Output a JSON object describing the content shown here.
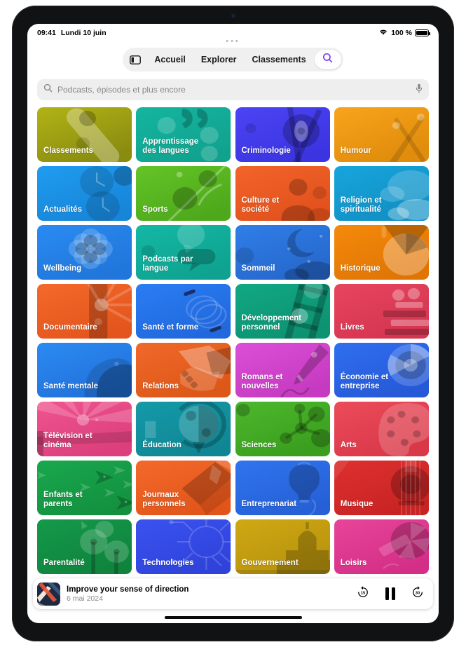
{
  "status_bar": {
    "time": "09:41",
    "date": "Lundi 10 juin",
    "battery_percent": "100 %",
    "wifi_icon": "wifi-icon",
    "battery_icon": "battery-full-icon"
  },
  "nav": {
    "sidebar_icon": "sidebar-toggle-icon",
    "items": [
      {
        "label": "Accueil"
      },
      {
        "label": "Explorer"
      },
      {
        "label": "Classements"
      }
    ],
    "search_icon": "search-icon",
    "search_icon_color": "#7d3ff2"
  },
  "search": {
    "placeholder": "Podcasts, épisodes et plus encore",
    "value": "",
    "leading_icon": "search-icon",
    "trailing_icon": "microphone-icon"
  },
  "categories": [
    {
      "label": "Classements",
      "art": "ranking",
      "c1": "#b2b316",
      "c2": "#8a8c10"
    },
    {
      "label": "Apprentissage des langues",
      "art": "quotes",
      "c1": "#14b5a0",
      "c2": "#11a28e"
    },
    {
      "label": "Criminologie",
      "art": "eye",
      "c1": "#4b44f5",
      "c2": "#3b34e0"
    },
    {
      "label": "Humour",
      "art": "confetti",
      "c1": "#f8a41c",
      "c2": "#e08c0c"
    },
    {
      "label": "Actualités",
      "art": "clocks",
      "c1": "#1f9cf0",
      "c2": "#1785d8"
    },
    {
      "label": "Sports",
      "art": "leaf",
      "c1": "#63c426",
      "c2": "#4ea81c"
    },
    {
      "label": "Culture et société",
      "art": "people",
      "c1": "#f2642a",
      "c2": "#e2511c"
    },
    {
      "label": "Religion et spiritualité",
      "art": "clouds",
      "c1": "#17a5dc",
      "c2": "#1190c4"
    },
    {
      "label": "Wellbeing",
      "art": "flower",
      "c1": "#2a8bf2",
      "c2": "#2076da"
    },
    {
      "label": "Podcasts par langue",
      "art": "bubbles",
      "c1": "#13b8a4",
      "c2": "#0fa290"
    },
    {
      "label": "Sommeil",
      "art": "moon",
      "c1": "#2f7ee8",
      "c2": "#2668cc"
    },
    {
      "label": "Historique",
      "art": "pie",
      "c1": "#f58a0b",
      "c2": "#e07505"
    },
    {
      "label": "Documentaire",
      "art": "filmstrip",
      "c1": "#f4692b",
      "c2": "#e3551c"
    },
    {
      "label": "Santé et forme",
      "art": "skipping",
      "c1": "#2a7df4",
      "c2": "#2168dc"
    },
    {
      "label": "Développement personnel",
      "art": "ladder",
      "c1": "#11a883",
      "c2": "#0d9272"
    },
    {
      "label": "Livres",
      "art": "books",
      "c1": "#e8455f",
      "c2": "#d43550"
    },
    {
      "label": "Santé mentale",
      "art": "heads",
      "c1": "#2a8bf2",
      "c2": "#2271da"
    },
    {
      "label": "Relations",
      "art": "handshake",
      "c1": "#f0692a",
      "c2": "#dd5718"
    },
    {
      "label": "Romans et nouvelles",
      "art": "pen",
      "c1": "#dc4fd8",
      "c2": "#c53ac0"
    },
    {
      "label": "Économie et entreprise",
      "art": "chart",
      "c1": "#2f6ff0",
      "c2": "#2659d8"
    },
    {
      "label": "Télévision et cinéma",
      "art": "rays",
      "c1": "#ef5590",
      "c2": "#dc3f7c"
    },
    {
      "label": "Éducation",
      "art": "globe",
      "c1": "#149aa8",
      "c2": "#108694"
    },
    {
      "label": "Sciences",
      "art": "molecule",
      "c1": "#4cb82c",
      "c2": "#3a9e1e"
    },
    {
      "label": "Arts",
      "art": "palette",
      "c1": "#ec4b5a",
      "c2": "#d83848"
    },
    {
      "label": "Enfants et parents",
      "art": "fish",
      "c1": "#19a84e",
      "c2": "#13913f"
    },
    {
      "label": "Journaux personnels",
      "art": "journal",
      "c1": "#f4692b",
      "c2": "#e2551a"
    },
    {
      "label": "Entreprenariat",
      "art": "bulb",
      "c1": "#2f74ee",
      "c2": "#2660d6"
    },
    {
      "label": "Musique",
      "art": "guitar",
      "c1": "#de3030",
      "c2": "#c82323"
    },
    {
      "label": "Parentalité",
      "art": "trees",
      "c1": "#14994a",
      "c2": "#10843d"
    },
    {
      "label": "Technologies",
      "art": "circuit",
      "c1": "#3b52f0",
      "c2": "#2f43da"
    },
    {
      "label": "Gouvernement",
      "art": "capitol",
      "c1": "#cfa814",
      "c2": "#b8930c"
    },
    {
      "label": "Loisirs",
      "art": "kite",
      "c1": "#e8449a",
      "c2": "#d42f86"
    }
  ],
  "player": {
    "title": "Improve your sense of direction",
    "date": "6 mai 2024",
    "skip_back_label": "15",
    "skip_forward_label": "30",
    "play_state_icon": "pause-icon",
    "skip_back_icon": "skip-back-15-icon",
    "skip_forward_icon": "skip-forward-30-icon"
  }
}
